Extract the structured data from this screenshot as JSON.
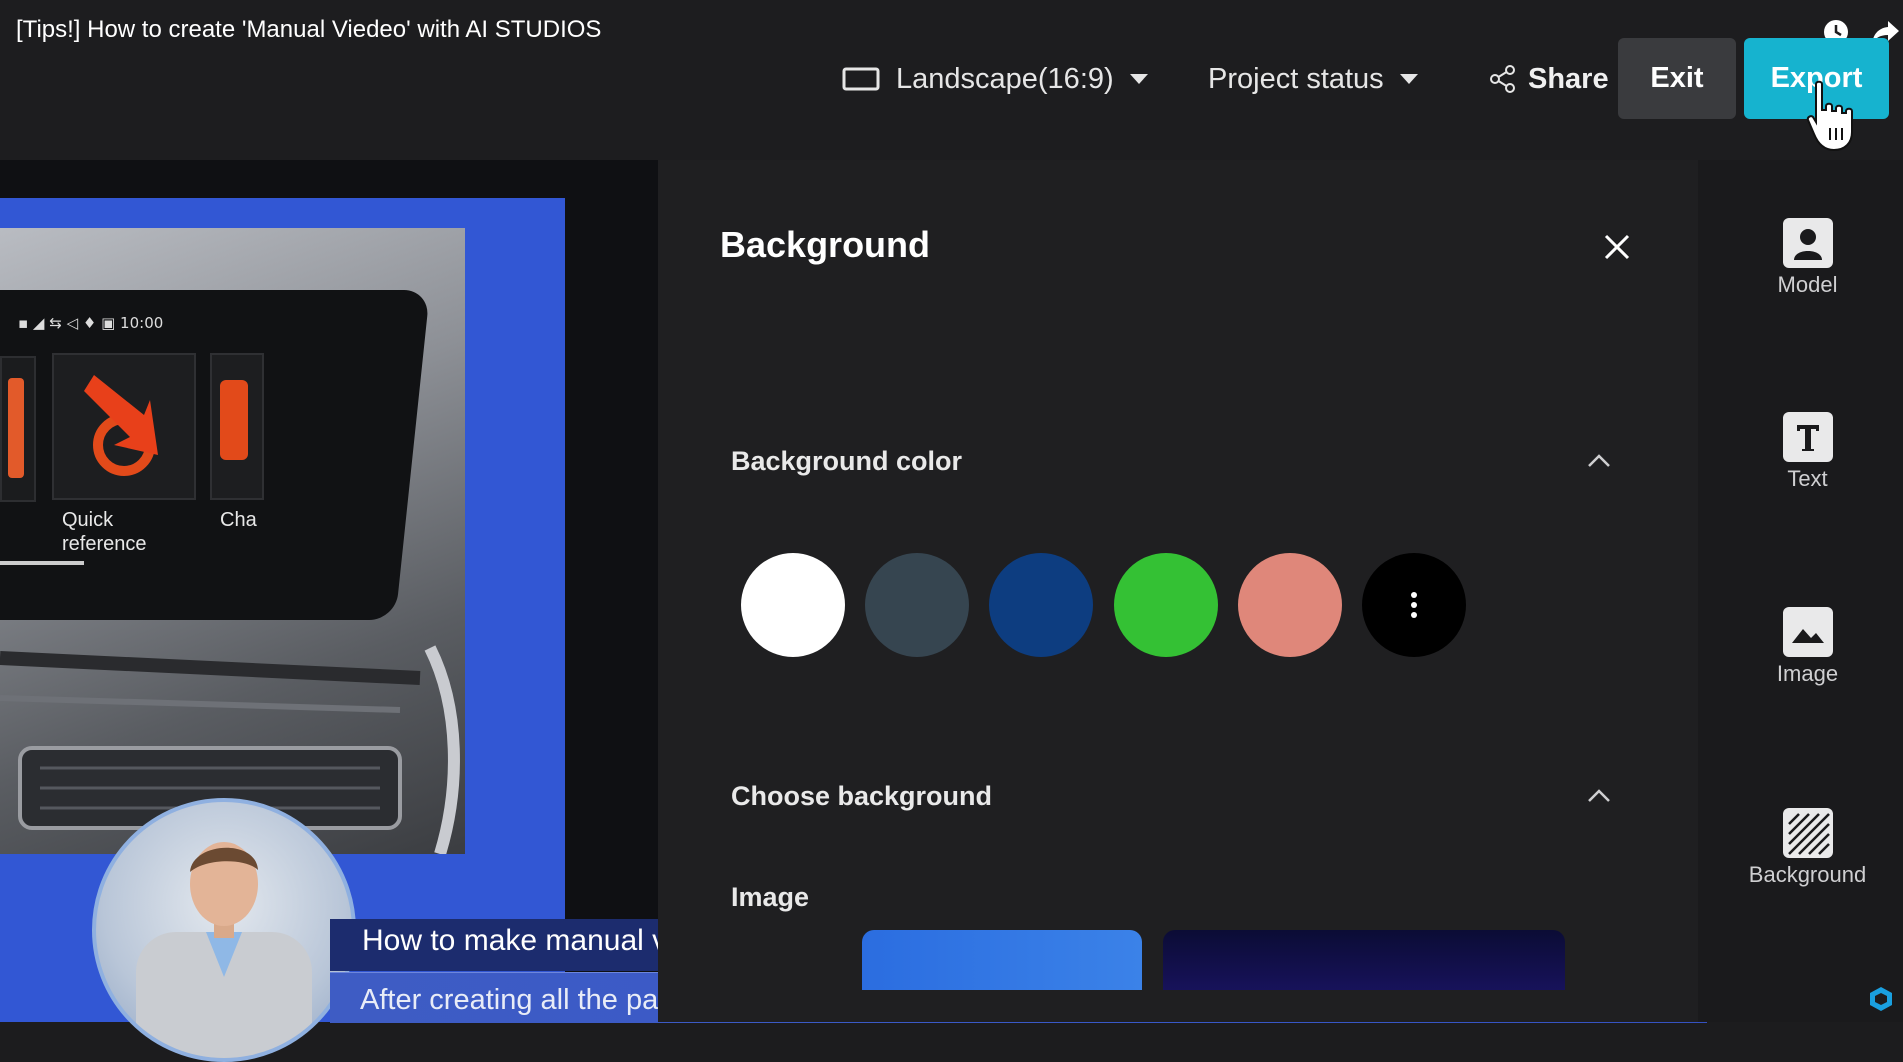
{
  "video": {
    "title": "[Tips!] How to create 'Manual Viedeo' with AI STUDIOS"
  },
  "toolbar": {
    "aspect_label": "Landscape(16:9)",
    "project_status_label": "Project status",
    "share_label": "Share",
    "exit_label": "Exit",
    "export_label": "Export"
  },
  "panel": {
    "title": "Background",
    "background_color": {
      "title": "Background color",
      "swatches": [
        "#ffffff",
        "#364550",
        "#0d3d80",
        "#34c134",
        "#df877a",
        "#000000"
      ]
    },
    "choose_background": {
      "title": "Choose background",
      "image_label": "Image"
    }
  },
  "rail": {
    "items": [
      {
        "label": "Model",
        "icon": "person-icon"
      },
      {
        "label": "Text",
        "icon": "text-t-icon"
      },
      {
        "label": "Image",
        "icon": "image-icon"
      },
      {
        "label": "Background",
        "icon": "hatch-icon"
      }
    ]
  },
  "slide": {
    "statusbar_time": "10:00",
    "quick_reference": "Quick\nreference",
    "tile_cut_label": "Cha",
    "lower_third_title": "How to make manual video",
    "caption": "After creating all the pages, click the export button."
  },
  "colors": {
    "accent": "#16b3cf",
    "slide_blue": "#3257d4",
    "panel_bg": "#1f1f21"
  }
}
